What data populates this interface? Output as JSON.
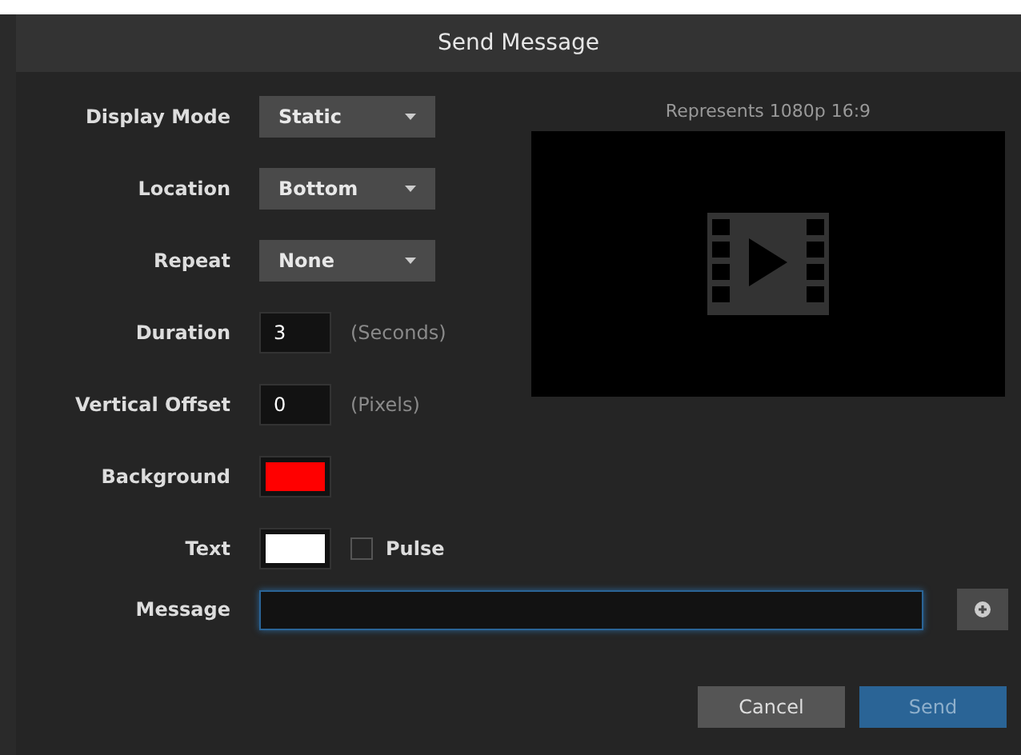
{
  "dialog": {
    "title": "Send Message"
  },
  "fields": [
    {
      "kind": "select",
      "label": "Display Mode",
      "value": "Static"
    },
    {
      "kind": "select",
      "label": "Location",
      "value": "Bottom"
    },
    {
      "kind": "select",
      "label": "Repeat",
      "value": "None"
    },
    {
      "kind": "number",
      "label": "Duration",
      "value": "3",
      "unit": "(Seconds)"
    },
    {
      "kind": "number",
      "label": "Vertical Offset",
      "value": "0",
      "unit": "(Pixels)"
    },
    {
      "kind": "color",
      "label": "Background",
      "color": "#ff0000"
    },
    {
      "kind": "color",
      "label": "Text",
      "color": "#ffffff",
      "checkbox": {
        "label": "Pulse",
        "checked": false
      }
    }
  ],
  "preview": {
    "caption": "Represents 1080p 16:9"
  },
  "message": {
    "label": "Message",
    "focused": true
  },
  "buttons": [
    {
      "label": "Cancel",
      "kind": "secondary"
    },
    {
      "label": "Send",
      "kind": "primary"
    }
  ]
}
